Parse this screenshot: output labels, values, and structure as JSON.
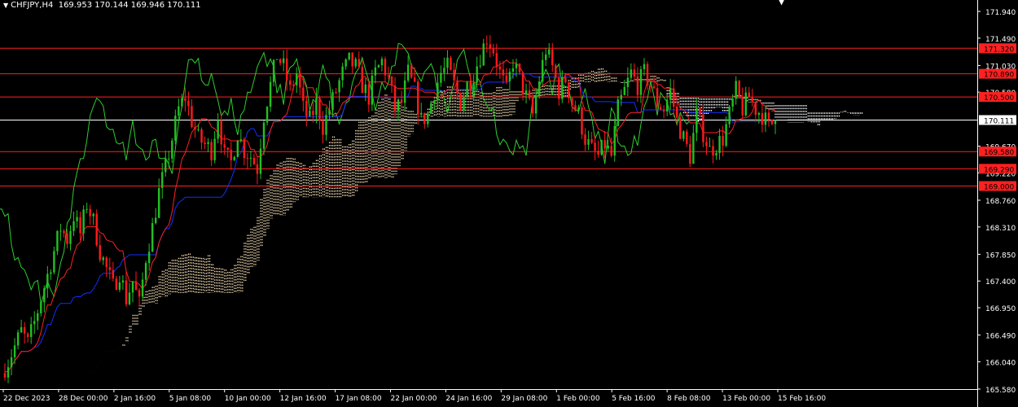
{
  "header": {
    "symbol": "CHFJPY,H4",
    "ohlc": "169.953 170.144 169.946 170.111"
  },
  "colors": {
    "background": "#000000",
    "axis": "#ffffff",
    "bull_candle": "#22c022",
    "bear_candle": "#ff1a1a",
    "tenkan": "#ff2020",
    "kijun": "#1030ff",
    "chikou": "#2ecc2e",
    "cloud_bull": "#f5deb3",
    "cloud_bear": "#ffffff",
    "level_line": "#ff2020",
    "current_price_line": "#ffffff"
  },
  "chart_data": {
    "type": "candlestick",
    "indicator": "Ichimoku Kinko Hyo",
    "ylim": [
      165.58,
      172.05
    ],
    "y_ticks": [
      {
        "value": 171.94,
        "label": "171.940"
      },
      {
        "value": 171.49,
        "label": "171.490"
      },
      {
        "value": 171.03,
        "label": "171.030"
      },
      {
        "value": 170.58,
        "label": "170.580"
      },
      {
        "value": 169.67,
        "label": "169.670"
      },
      {
        "value": 169.22,
        "label": "169.220"
      },
      {
        "value": 168.76,
        "label": "168.760"
      },
      {
        "value": 168.31,
        "label": "168.310"
      },
      {
        "value": 167.85,
        "label": "167.850"
      },
      {
        "value": 167.4,
        "label": "167.400"
      },
      {
        "value": 166.95,
        "label": "166.950"
      },
      {
        "value": 166.49,
        "label": "166.490"
      },
      {
        "value": 166.04,
        "label": "166.040"
      },
      {
        "value": 165.58,
        "label": "165.580"
      }
    ],
    "x_labels": [
      "22 Dec 2023",
      "28 Dec 00:00",
      "2 Jan 16:00",
      "5 Jan 08:00",
      "10 Jan 00:00",
      "12 Jan 16:00",
      "17 Jan 08:00",
      "22 Jan 00:00",
      "24 Jan 16:00",
      "29 Jan 08:00",
      "1 Feb 00:00",
      "5 Feb 16:00",
      "8 Feb 08:00",
      "13 Feb 00:00",
      "15 Feb 16:00"
    ],
    "levels": [
      {
        "value": 171.32,
        "label": "171.320"
      },
      {
        "value": 170.89,
        "label": "170.890"
      },
      {
        "value": 170.5,
        "label": "170.500"
      },
      {
        "value": 169.58,
        "label": "169.580"
      },
      {
        "value": 169.29,
        "label": "169.290"
      },
      {
        "value": 169.0,
        "label": "169.000"
      }
    ],
    "current_price": {
      "value": 170.111,
      "label": "170.111"
    },
    "closes": [
      166.05,
      166.3,
      166.55,
      166.35,
      166.7,
      167.1,
      167.5,
      167.9,
      168.3,
      168.1,
      168.5,
      168.2,
      168.7,
      168.4,
      167.9,
      167.6,
      167.3,
      167.55,
      167.1,
      167.4,
      167.0,
      167.8,
      168.3,
      168.9,
      169.3,
      169.8,
      170.3,
      170.5,
      170.1,
      169.8,
      169.7,
      169.6,
      170.2,
      169.5,
      169.4,
      169.9,
      169.6,
      169.5,
      169.3,
      170.2,
      170.7,
      171.2,
      171.0,
      170.6,
      170.9,
      170.3,
      170.1,
      170.4,
      170.0,
      170.3,
      170.6,
      170.9,
      171.1,
      171.0,
      170.7,
      170.5,
      170.9,
      171.1,
      170.8,
      170.3,
      170.4,
      170.9,
      170.6,
      170.1,
      170.2,
      170.6,
      170.9,
      171.0,
      170.7,
      170.4,
      170.7,
      170.9,
      171.2,
      171.5,
      171.3,
      170.9,
      170.6,
      171.1,
      170.8,
      170.5,
      170.2,
      170.8,
      171.3,
      171.0,
      170.6,
      170.8,
      170.4,
      170.2,
      169.8,
      169.6,
      169.5,
      169.7,
      169.5,
      170.3,
      170.6,
      170.9,
      170.7,
      170.9,
      170.7,
      170.4,
      170.3,
      170.6,
      170.1,
      169.8,
      169.5,
      170.2,
      169.9,
      169.6,
      169.7,
      169.8,
      170.2,
      170.6,
      170.3,
      170.5,
      170.3,
      170.2,
      170.0,
      170.111
    ],
    "y_axis_side": "right",
    "grid": false
  }
}
